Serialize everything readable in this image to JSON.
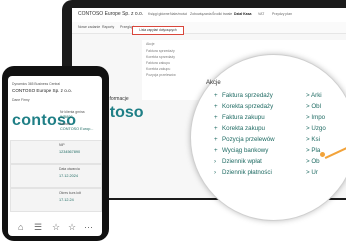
{
  "laptop": {
    "company": "CONTOSO Europe Sp. z o.o.",
    "nav": [
      "Księgi główne",
      "Należności",
      "Zobowiązania",
      "Środki trwałe",
      "Dział Kasa",
      "VAT",
      "Przydzy plan"
    ],
    "subnav": [
      "Nowe zadanie",
      "Raporty",
      "Przegląd"
    ],
    "redbox_text": "Lista zapytań dotyczących",
    "panel_lines": [
      "Akcje",
      "Faktura sprzedaży",
      "Korekta sprzedaży",
      "Faktura zakupu",
      "Korekta zakupu",
      "Pozycja przelewów"
    ]
  },
  "phone": {
    "app_name": "Dynamics 365 Business Central",
    "company": "CONTOSO Europe Sp. z o.o.",
    "subtitle": "Dane Firmy",
    "logo": "contoso",
    "field1_label": "Nr klienta gmina",
    "field1_value": "WB808",
    "field2_label": "Nazwa",
    "field2_value": "CONTOSO Europ...",
    "field3_label": "NIP",
    "field3_value": "1234567890",
    "field4_label": "Data otwarcia",
    "field4_value": "17.12.2024",
    "field5_label": "Okres kurs kdt",
    "field5_value": "17.12.24"
  },
  "laptop_left": {
    "logo": "ntoso",
    "heading": "ry informacje"
  },
  "zoom": {
    "heading": "Akcje",
    "items": [
      {
        "sym": "+",
        "label": "Faktura sprzedaży"
      },
      {
        "sym": "+",
        "label": "Korekta sprzedaży"
      },
      {
        "sym": "+",
        "label": "Faktura zakupu"
      },
      {
        "sym": "+",
        "label": "Korekta zakupu"
      },
      {
        "sym": "+",
        "label": "Pozycja przelewów"
      },
      {
        "sym": "+",
        "label": "Wyciąg bankowy"
      },
      {
        "sym": "›",
        "label": "Dziennik wpłat"
      },
      {
        "sym": "›",
        "label": "Dziennik płatności"
      }
    ],
    "side": [
      {
        "sym": ">",
        "label": "Arki"
      },
      {
        "sym": ">",
        "label": "Obl"
      },
      {
        "sym": ">",
        "label": "Impo"
      },
      {
        "sym": ">",
        "label": "Uzgo"
      },
      {
        "sym": ">",
        "label": "Ksi"
      },
      {
        "sym": ">",
        "label": "Pla"
      },
      {
        "sym": ">",
        "label": "Ob"
      },
      {
        "sym": ">",
        "label": "Ur"
      }
    ]
  }
}
